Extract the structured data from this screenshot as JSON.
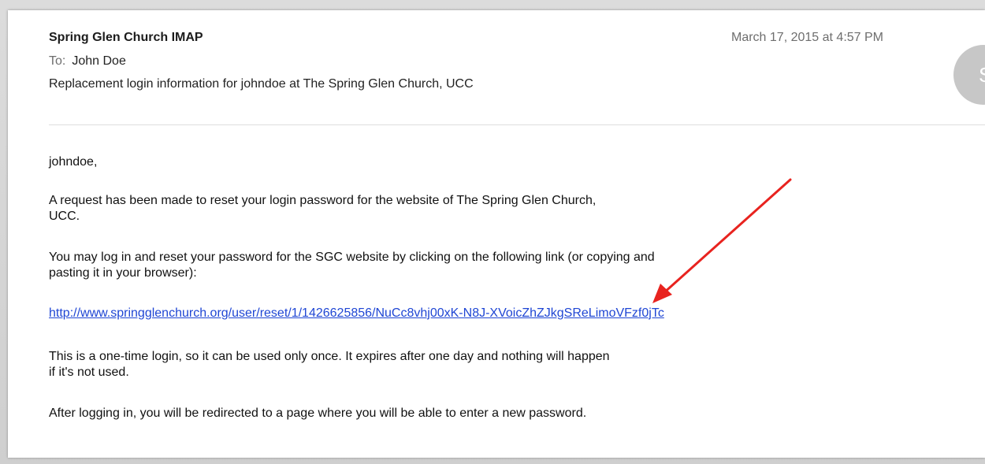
{
  "email": {
    "sender": "Spring Glen Church IMAP",
    "date": "March 17, 2015 at 4:57 PM",
    "to_label": "To:",
    "to_value": "John Doe",
    "subject": "Replacement login information for johndoe at The Spring Glen Church, UCC",
    "avatar_initial": "S"
  },
  "body": {
    "greeting": "johndoe,",
    "p_request": "A request has been made to reset your login password for the website of The Spring Glen Church, UCC.",
    "p_link_intro": "You may log in and reset your password for the SGC website by clicking on the following link (or copying and pasting it in your browser):",
    "reset_link": "http://www.springglenchurch.org/user/reset/1/1426625856/NuCc8vhj00xK-N8J-XVoicZhZJkgSReLimoVFzf0jTc",
    "p_one_time": "This is a one-time login, so it can be used only once. It expires after one day and nothing will happen if it's not used.",
    "p_redirect": "After logging in, you will be redirected to a page where you will be able to enter a new password."
  },
  "annotation": {
    "arrow_color": "#e8231f"
  }
}
